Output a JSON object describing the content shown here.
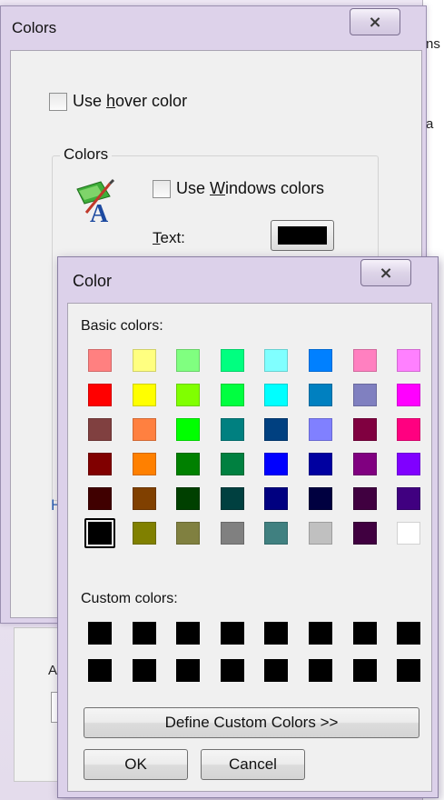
{
  "background": {
    "right_fragments": [
      "ns",
      "a"
    ],
    "bottom_fragment": "A",
    "link_fragment": "H"
  },
  "colors_dialog": {
    "title": "Colors",
    "close_glyph": "⨯",
    "hover_checkbox": {
      "pre": "Use ",
      "accel": "h",
      "post": "over color",
      "checked": false
    },
    "group_title": "Colors",
    "windows_checkbox": {
      "pre": "Use ",
      "accel": "W",
      "post": "indows colors",
      "checked": false
    },
    "text_label": {
      "accel": "T",
      "post": "ext:"
    },
    "text_color": "#000000"
  },
  "color_dialog": {
    "title": "Color",
    "close_glyph": "⨯",
    "basic_label": "Basic colors:",
    "basic_colors": [
      "#ff8080",
      "#ffff80",
      "#80ff80",
      "#00ff80",
      "#80ffff",
      "#0080ff",
      "#ff80c0",
      "#ff80ff",
      "#ff0000",
      "#ffff00",
      "#80ff00",
      "#00ff40",
      "#00ffff",
      "#0080c0",
      "#8080c0",
      "#ff00ff",
      "#804040",
      "#ff8040",
      "#00ff00",
      "#008080",
      "#004080",
      "#8080ff",
      "#800040",
      "#ff0080",
      "#800000",
      "#ff8000",
      "#008000",
      "#008040",
      "#0000ff",
      "#0000a0",
      "#800080",
      "#8000ff",
      "#400000",
      "#804000",
      "#004000",
      "#004040",
      "#000080",
      "#000040",
      "#400040",
      "#400080",
      "#000000",
      "#808000",
      "#808040",
      "#808080",
      "#408080",
      "#c0c0c0",
      "#400040",
      "#ffffff"
    ],
    "selected_index": 40,
    "custom_label": "Custom colors:",
    "custom_colors": [
      "#000000",
      "#000000",
      "#000000",
      "#000000",
      "#000000",
      "#000000",
      "#000000",
      "#000000",
      "#000000",
      "#000000",
      "#000000",
      "#000000",
      "#000000",
      "#000000",
      "#000000",
      "#000000"
    ],
    "define_button": "Define Custom Colors >>",
    "ok_button": "OK",
    "cancel_button": "Cancel"
  }
}
